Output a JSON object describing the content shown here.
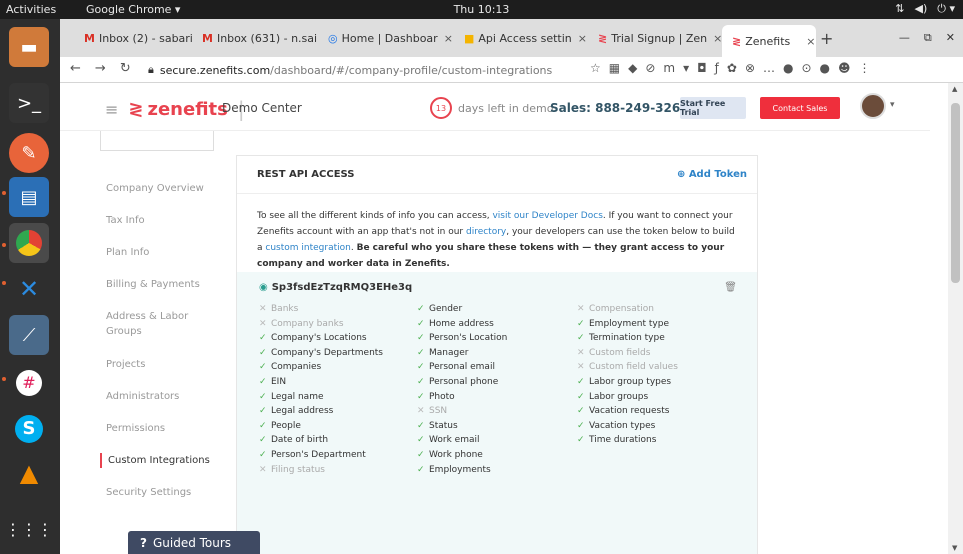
{
  "topbar": {
    "activities": "Activities",
    "app_menu": "Google Chrome ▾",
    "clock": "Thu 10:13"
  },
  "tabs": [
    {
      "icon": "M",
      "label": "Inbox (2) - sabari@"
    },
    {
      "icon": "M",
      "label": "Inbox (631) - n.sai"
    },
    {
      "icon": "◎",
      "label": "Home | Dashboar"
    },
    {
      "icon": "■",
      "label": "Api Access settin"
    },
    {
      "icon": "≷",
      "label": "Trial Signup | Zen"
    },
    {
      "icon": "≷",
      "label": "Zenefits"
    }
  ],
  "omnibox": {
    "domain": "secure.zenefits.com",
    "path": "/dashboard/#/company-profile/custom-integrations"
  },
  "header": {
    "brand": "zenefits",
    "demo": "Demo Center",
    "days_num": "13",
    "days_text": "days left in demo",
    "sales": "Sales: 888-249-3263",
    "trial": "Start Free Trial",
    "contact": "Contact Sales"
  },
  "sidebar": {
    "items": [
      "Company Overview",
      "Tax Info",
      "Plan Info",
      "Billing & Payments",
      "Address & Labor Groups",
      "Projects",
      "Administrators",
      "Permissions",
      "Custom Integrations",
      "Security Settings"
    ]
  },
  "card": {
    "title": "REST API ACCESS",
    "add_token": "Add Token",
    "intro": {
      "p1": "To see all the different kinds of info you can access, ",
      "link1": "visit our Developer Docs",
      "p2": ". If you want to connect your Zenefits account with an app that's not in our ",
      "link2": "directory",
      "p3": ", your developers can use the token below to build a ",
      "link3": "custom integration",
      "p4": ". ",
      "bold": "Be careful who you share these tokens with — they grant access to your company and worker data in Zenefits."
    },
    "token": "Sp3fsdEzTzqRMQ3EHe3q",
    "columns": [
      [
        {
          "label": "Banks",
          "on": false
        },
        {
          "label": "Company banks",
          "on": false
        },
        {
          "label": "Company's Locations",
          "on": true
        },
        {
          "label": "Company's Departments",
          "on": true
        },
        {
          "label": "Companies",
          "on": true
        },
        {
          "label": "EIN",
          "on": true
        },
        {
          "label": "Legal name",
          "on": true
        },
        {
          "label": "Legal address",
          "on": true
        },
        {
          "label": "People",
          "on": true
        },
        {
          "label": "Date of birth",
          "on": true
        },
        {
          "label": "Person's Department",
          "on": true
        },
        {
          "label": "Filing status",
          "on": false
        }
      ],
      [
        {
          "label": "Gender",
          "on": true
        },
        {
          "label": "Home address",
          "on": true
        },
        {
          "label": "Person's Location",
          "on": true
        },
        {
          "label": "Manager",
          "on": true
        },
        {
          "label": "Personal email",
          "on": true
        },
        {
          "label": "Personal phone",
          "on": true
        },
        {
          "label": "Photo",
          "on": true
        },
        {
          "label": "SSN",
          "on": false
        },
        {
          "label": "Status",
          "on": true
        },
        {
          "label": "Work email",
          "on": true
        },
        {
          "label": "Work phone",
          "on": true
        },
        {
          "label": "Employments",
          "on": true
        }
      ],
      [
        {
          "label": "Compensation",
          "on": false
        },
        {
          "label": "Employment type",
          "on": true
        },
        {
          "label": "Termination type",
          "on": true
        },
        {
          "label": "Custom fields",
          "on": false
        },
        {
          "label": "Custom field values",
          "on": false
        },
        {
          "label": "Labor group types",
          "on": true
        },
        {
          "label": "Labor groups",
          "on": true
        },
        {
          "label": "Vacation requests",
          "on": true
        },
        {
          "label": "Vacation types",
          "on": true
        },
        {
          "label": "Time durations",
          "on": true
        }
      ]
    ]
  },
  "guided_tours": "Guided Tours"
}
